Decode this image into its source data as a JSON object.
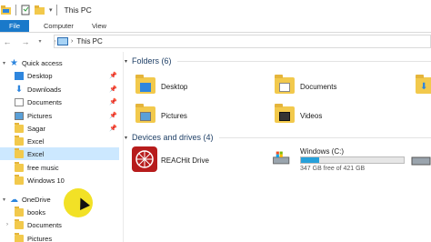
{
  "titlebar": {
    "title": "This PC"
  },
  "ribbon": {
    "tabs": [
      "File",
      "Computer",
      "View"
    ]
  },
  "address": {
    "crumb": "This PC"
  },
  "nav": {
    "quick_access": "Quick access",
    "items": [
      {
        "label": "Desktop",
        "pinned": true
      },
      {
        "label": "Downloads",
        "pinned": true
      },
      {
        "label": "Documents",
        "pinned": true
      },
      {
        "label": "Pictures",
        "pinned": true
      },
      {
        "label": "Sagar",
        "pinned": true
      },
      {
        "label": "Excel",
        "pinned": false
      },
      {
        "label": "Excel",
        "pinned": false
      },
      {
        "label": "free music",
        "pinned": false
      },
      {
        "label": "Windows 10",
        "pinned": false
      }
    ],
    "onedrive": "OneDrive",
    "onedrive_items": [
      {
        "label": "books"
      },
      {
        "label": "Documents"
      },
      {
        "label": "Pictures"
      }
    ]
  },
  "content": {
    "folders_title": "Folders (6)",
    "folders": [
      {
        "label": "Desktop"
      },
      {
        "label": "Documents"
      },
      {
        "label": "Pictures"
      },
      {
        "label": "Videos"
      }
    ],
    "devices_title": "Devices and drives (4)",
    "drives": [
      {
        "label": "REACHit Drive"
      },
      {
        "label": "Windows (C:)",
        "free_text": "347 GB free of 421 GB",
        "used_fraction": 0.18
      }
    ]
  },
  "colors": {
    "accent": "#1979ca",
    "selection": "#cce8ff",
    "drive_bar": "#26a0da"
  }
}
